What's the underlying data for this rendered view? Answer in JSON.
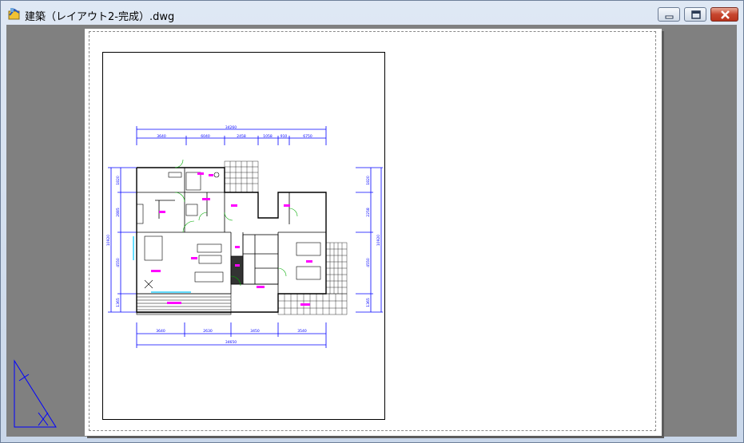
{
  "window": {
    "title": "建築（レイアウト2-完成）.dwg",
    "controls": {
      "minimize_icon": "minimize-icon",
      "maximize_icon": "restore-icon",
      "close_icon": "close-icon"
    }
  },
  "colors": {
    "desktop_bg": "#808080",
    "paper": "#ffffff",
    "dimension": "#0000ff",
    "room_label": "#ff00ff",
    "door": "#00aa00",
    "window_glass": "#00c8ff",
    "ucs": "#0000ff"
  },
  "drawing": {
    "dims_top": {
      "total": "34260",
      "parts": [
        "3640",
        "6040",
        "2458",
        "1058",
        "910",
        "6750"
      ]
    },
    "dims_bottom": {
      "total": "34650",
      "parts": [
        "3640",
        "2630",
        "3450",
        "3540"
      ]
    },
    "dims_left": {
      "total": "10920",
      "parts": [
        "1820",
        "2885",
        "4550",
        "1365"
      ]
    },
    "dims_right": {
      "total": "10920",
      "parts": [
        "1820",
        "2258",
        "4550",
        "1365"
      ]
    }
  }
}
